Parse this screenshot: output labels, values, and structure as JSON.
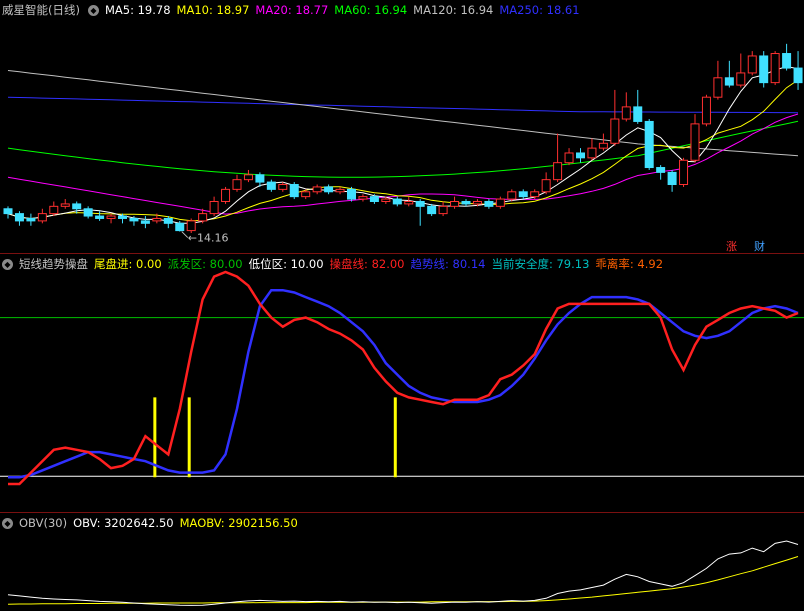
{
  "main_panel": {
    "title": "威星智能(日线)",
    "ma_labels": [
      {
        "text": "MA5: 19.78",
        "color": "#ffffff"
      },
      {
        "text": "MA10: 18.97",
        "color": "#ffff00"
      },
      {
        "text": "MA20: 18.77",
        "color": "#ff00ff"
      },
      {
        "text": "MA60: 16.94",
        "color": "#00ff00"
      },
      {
        "text": "MA120: 16.94",
        "color": "#c0c0c0"
      },
      {
        "text": "MA250: 18.61",
        "color": "#3030ff"
      }
    ],
    "low_label": "14.16",
    "tag_rise": "涨",
    "tag_cai": "财"
  },
  "indicator_panel": {
    "title": "短线趋势操盘",
    "params": [
      {
        "text": "尾盘进: 0.00",
        "color": "#ffff00"
      },
      {
        "text": "派发区: 80.00",
        "color": "#00c000"
      },
      {
        "text": "低位区: 10.00",
        "color": "#ffffff"
      },
      {
        "text": "操盘线: 82.00",
        "color": "#ff2020"
      },
      {
        "text": "趋势线: 80.14",
        "color": "#3030ff"
      },
      {
        "text": "当前安全度: 79.13",
        "color": "#00c0c0"
      },
      {
        "text": "乖离率: 4.92",
        "color": "#ff6000"
      }
    ]
  },
  "obv_panel": {
    "title": "OBV(30)",
    "params": [
      {
        "text": "OBV: 3202642.50",
        "color": "#ffffff"
      },
      {
        "text": "MAOBV: 2902156.50",
        "color": "#ffff00"
      }
    ]
  },
  "colors": {
    "up": "#ff3030",
    "down": "#40e0ff",
    "ma5": "#ffffff",
    "ma10": "#ffff00",
    "ma20": "#ff00ff",
    "ma60": "#00ff00",
    "ma120": "#c0c0c0",
    "ma250": "#3030ff",
    "operate": "#ff2020",
    "trend": "#3030ff",
    "distribute": "#00c000",
    "low": "#ffffff",
    "signal": "#ffff00",
    "obv": "#ffffff",
    "maobv": "#ffff00"
  },
  "chart_data": [
    {
      "type": "candlestick",
      "title": "威星智能(日线)",
      "note": "daily price chart; values estimated",
      "ylim": [
        13.4,
        22.8
      ],
      "candles": [
        [
          15.1,
          14.9,
          15.2,
          14.7
        ],
        [
          14.9,
          14.6,
          15.0,
          14.4
        ],
        [
          14.7,
          14.6,
          14.9,
          14.4
        ],
        [
          14.6,
          14.9,
          15.1,
          14.5
        ],
        [
          14.9,
          15.2,
          15.4,
          14.8
        ],
        [
          15.2,
          15.3,
          15.5,
          15.1
        ],
        [
          15.3,
          15.1,
          15.4,
          14.9
        ],
        [
          15.1,
          14.8,
          15.2,
          14.7
        ],
        [
          14.8,
          14.7,
          15.0,
          14.6
        ],
        [
          14.7,
          14.8,
          14.9,
          14.5
        ],
        [
          14.8,
          14.7,
          14.9,
          14.5
        ],
        [
          14.7,
          14.6,
          14.8,
          14.4
        ],
        [
          14.6,
          14.5,
          14.8,
          14.3
        ],
        [
          14.6,
          14.7,
          14.9,
          14.5
        ],
        [
          14.7,
          14.5,
          14.8,
          14.3
        ],
        [
          14.5,
          14.2,
          14.6,
          14.16
        ],
        [
          14.2,
          14.6,
          14.7,
          14.1
        ],
        [
          14.6,
          14.9,
          15.1,
          14.5
        ],
        [
          14.9,
          15.4,
          15.6,
          14.8
        ],
        [
          15.4,
          15.9,
          16.0,
          15.3
        ],
        [
          15.9,
          16.3,
          16.5,
          15.8
        ],
        [
          16.3,
          16.5,
          16.7,
          16.2
        ],
        [
          16.5,
          16.2,
          16.6,
          16.0
        ],
        [
          16.2,
          15.9,
          16.3,
          15.8
        ],
        [
          15.9,
          16.1,
          16.2,
          15.8
        ],
        [
          16.1,
          15.6,
          16.2,
          15.5
        ],
        [
          15.6,
          15.8,
          15.9,
          15.5
        ],
        [
          15.8,
          16.0,
          16.1,
          15.7
        ],
        [
          16.0,
          15.8,
          16.1,
          15.7
        ],
        [
          15.8,
          15.9,
          16.0,
          15.7
        ],
        [
          15.9,
          15.5,
          16.0,
          15.4
        ],
        [
          15.5,
          15.6,
          15.7,
          15.4
        ],
        [
          15.6,
          15.4,
          15.7,
          15.3
        ],
        [
          15.4,
          15.5,
          15.6,
          15.3
        ],
        [
          15.5,
          15.3,
          15.6,
          15.2
        ],
        [
          15.3,
          15.4,
          15.6,
          15.2
        ],
        [
          15.4,
          15.2,
          15.5,
          14.4
        ],
        [
          15.2,
          14.9,
          15.3,
          14.8
        ],
        [
          14.9,
          15.2,
          15.4,
          14.8
        ],
        [
          15.2,
          15.4,
          15.6,
          15.1
        ],
        [
          15.4,
          15.3,
          15.5,
          15.2
        ],
        [
          15.3,
          15.4,
          15.5,
          15.2
        ],
        [
          15.4,
          15.2,
          15.5,
          15.1
        ],
        [
          15.2,
          15.5,
          15.6,
          15.1
        ],
        [
          15.5,
          15.8,
          15.9,
          15.4
        ],
        [
          15.8,
          15.6,
          15.9,
          15.5
        ],
        [
          15.6,
          15.8,
          15.9,
          15.5
        ],
        [
          15.8,
          16.3,
          16.6,
          15.7
        ],
        [
          16.3,
          17.0,
          18.2,
          16.2
        ],
        [
          17.0,
          17.4,
          17.6,
          16.9
        ],
        [
          17.4,
          17.2,
          17.6,
          17.0
        ],
        [
          17.2,
          17.6,
          18.0,
          17.1
        ],
        [
          17.6,
          17.8,
          18.2,
          17.5
        ],
        [
          17.8,
          18.8,
          20.0,
          17.7
        ],
        [
          18.8,
          19.3,
          19.9,
          18.7
        ],
        [
          19.3,
          18.7,
          20.0,
          18.6
        ],
        [
          18.7,
          16.8,
          18.8,
          16.7
        ],
        [
          16.8,
          16.6,
          16.9,
          16.3
        ],
        [
          16.6,
          16.1,
          16.7,
          15.8
        ],
        [
          16.1,
          17.1,
          17.2,
          16.0
        ],
        [
          17.1,
          18.6,
          19.0,
          17.0
        ],
        [
          18.6,
          19.7,
          19.8,
          18.5
        ],
        [
          19.7,
          20.5,
          21.2,
          19.6
        ],
        [
          20.5,
          20.2,
          21.2,
          20.1
        ],
        [
          20.2,
          20.7,
          21.5,
          20.1
        ],
        [
          20.7,
          21.4,
          21.6,
          20.6
        ],
        [
          21.4,
          20.3,
          21.6,
          20.1
        ],
        [
          20.3,
          21.5,
          21.6,
          20.2
        ],
        [
          21.5,
          20.9,
          21.9,
          20.8
        ],
        [
          20.9,
          20.3,
          21.6,
          20.0
        ]
      ]
    },
    {
      "type": "line",
      "title": "短线趋势操盘",
      "ylim": [
        0,
        100
      ],
      "series": [
        {
          "name": "操盘线"
        },
        {
          "name": "趋势线"
        },
        {
          "name": "派发区"
        },
        {
          "name": "低位区"
        },
        {
          "name": "尾盘进"
        }
      ],
      "x": [
        0,
        1,
        2,
        3,
        4,
        5,
        6,
        7,
        8,
        9,
        10,
        11,
        12,
        13,
        14,
        15,
        16,
        17,
        18,
        19,
        20,
        21,
        22,
        23,
        24,
        25,
        26,
        27,
        28,
        29,
        30,
        31,
        32,
        33,
        34,
        35,
        36,
        37,
        38,
        39,
        40,
        41,
        42,
        43,
        44,
        45,
        46,
        47,
        48,
        49,
        50,
        51,
        52,
        53,
        54,
        55,
        56,
        57,
        58,
        59,
        60,
        61,
        62,
        63,
        64,
        65,
        66,
        67,
        68,
        69
      ],
      "operate": [
        7,
        7,
        12,
        17,
        22,
        23,
        22,
        21,
        18,
        14,
        15,
        18,
        28,
        24,
        20,
        40,
        65,
        88,
        98,
        100,
        98,
        94,
        86,
        80,
        76,
        79,
        80,
        78,
        75,
        73,
        70,
        66,
        58,
        52,
        47,
        45,
        44,
        43,
        42,
        44,
        44,
        44,
        46,
        53,
        55,
        59,
        64,
        75,
        84,
        86,
        86,
        86,
        86,
        86,
        86,
        86,
        86,
        80,
        66,
        57,
        68,
        76,
        79,
        82,
        84,
        85,
        84,
        83,
        80,
        82
      ],
      "trend": [
        10,
        10,
        11,
        13,
        15,
        17,
        19,
        21,
        21,
        20,
        19,
        18,
        17,
        15,
        13,
        12,
        12,
        12,
        13,
        20,
        40,
        65,
        85,
        92,
        92,
        91,
        89,
        87,
        85,
        82,
        78,
        74,
        68,
        60,
        55,
        50,
        47,
        45,
        44,
        43,
        43,
        43,
        44,
        46,
        50,
        55,
        62,
        70,
        77,
        82,
        86,
        89,
        89,
        89,
        89,
        88,
        86,
        82,
        78,
        74,
        72,
        71,
        72,
        74,
        78,
        82,
        84,
        85,
        84,
        82
      ],
      "distribute_level": 80,
      "low_level": 10,
      "signal_bars": [
        13,
        16,
        34
      ]
    },
    {
      "type": "line",
      "title": "OBV(30)",
      "series": [
        {
          "name": "OBV"
        },
        {
          "name": "MAOBV"
        }
      ],
      "obv": [
        1.1,
        1.05,
        1.0,
        0.95,
        0.92,
        0.9,
        0.88,
        0.85,
        0.82,
        0.8,
        0.78,
        0.75,
        0.72,
        0.7,
        0.68,
        0.66,
        0.65,
        0.66,
        0.7,
        0.75,
        0.8,
        0.84,
        0.86,
        0.84,
        0.82,
        0.83,
        0.81,
        0.82,
        0.8,
        0.82,
        0.79,
        0.8,
        0.78,
        0.79,
        0.77,
        0.78,
        0.76,
        0.74,
        0.77,
        0.79,
        0.78,
        0.8,
        0.79,
        0.82,
        0.85,
        0.83,
        0.86,
        0.95,
        1.15,
        1.25,
        1.3,
        1.4,
        1.5,
        1.75,
        1.95,
        1.85,
        1.65,
        1.55,
        1.45,
        1.6,
        1.9,
        2.2,
        2.6,
        2.8,
        2.85,
        3.05,
        2.9,
        3.25,
        3.35,
        3.2
      ],
      "maobv": [
        0.7,
        0.71,
        0.71,
        0.72,
        0.72,
        0.72,
        0.73,
        0.73,
        0.73,
        0.74,
        0.74,
        0.74,
        0.74,
        0.75,
        0.75,
        0.75,
        0.75,
        0.75,
        0.76,
        0.76,
        0.76,
        0.76,
        0.77,
        0.77,
        0.77,
        0.77,
        0.77,
        0.78,
        0.78,
        0.78,
        0.78,
        0.78,
        0.79,
        0.79,
        0.79,
        0.79,
        0.79,
        0.8,
        0.8,
        0.8,
        0.8,
        0.81,
        0.81,
        0.81,
        0.82,
        0.82,
        0.83,
        0.85,
        0.88,
        0.92,
        0.96,
        1.0,
        1.05,
        1.1,
        1.15,
        1.2,
        1.25,
        1.3,
        1.35,
        1.42,
        1.5,
        1.6,
        1.72,
        1.85,
        1.98,
        2.1,
        2.25,
        2.4,
        2.55,
        2.7
      ]
    }
  ]
}
